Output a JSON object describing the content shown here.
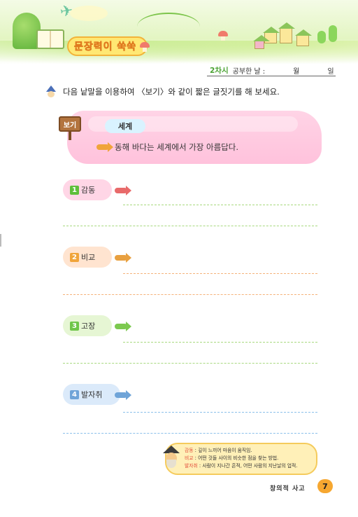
{
  "header": {
    "title": "문장력이 쑥쑥",
    "session_badge": "2차시",
    "study_date_label": "공부한 날 :",
    "month_label": "월",
    "day_label": "일"
  },
  "instruction": "다음 낱말을 이용하여 〈보기〉와 같이 짧은 글짓기를 해 보세요.",
  "example": {
    "label": "보기",
    "word": "세계",
    "sentence": "동해 바다는 세계에서 가장 아름답다."
  },
  "items": [
    {
      "number": "1",
      "word": "감동",
      "color": "#5fbf3a"
    },
    {
      "number": "2",
      "word": "비교",
      "color": "#f0a43a"
    },
    {
      "number": "3",
      "word": "고장",
      "color": "#6fc64a"
    },
    {
      "number": "4",
      "word": "발자취",
      "color": "#6fa4d8"
    }
  ],
  "glossary": [
    {
      "term": "감동",
      "definition": " : 깊이 느끼어 마음이 움직임."
    },
    {
      "term": "비교",
      "definition": " : 어떤 것들 사이의 비슷한 점을 찾는 방법."
    },
    {
      "term": "발자취",
      "definition": " : 사람이 지나간 흔적, 어떤 사람의 지난날의 업적."
    }
  ],
  "footer": {
    "section": "창의적 사고",
    "page_number": "7"
  },
  "colors": {
    "example_bg": "#ffc9df",
    "item1_bubble": "#ffd6e6",
    "item2_bubble": "#ffe4d0",
    "item3_bubble": "#e6f6d4",
    "item4_bubble": "#dbeafa"
  }
}
